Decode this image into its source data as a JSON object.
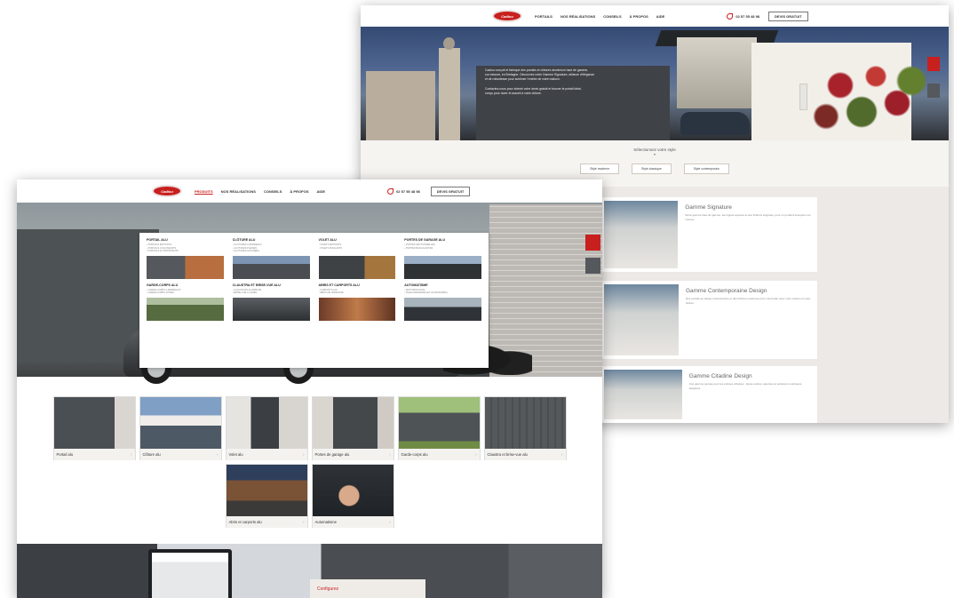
{
  "back_page": {
    "nav": {
      "logo_text": "Cadiou",
      "links": [
        "PORTAILS",
        "NOS RÉALISATIONS",
        "CONSEILS",
        "À PROPOS",
        "AIDE"
      ],
      "phone": "02 57 55 48 98",
      "quote_button": "DEVIS GRATUIT"
    },
    "hero_text": [
      "Cadiou conçoit et fabrique des portails et clôtures aluminium haut de gamme,",
      "sur mesure, en Bretagne. Découvrez notre Gamme Signature, alliance d'élégance",
      "et de robustesse pour sublimer l'entrée de votre maison.",
      "",
      "Contactez-nous pour obtenir votre devis gratuit et trouver le portail idéal,",
      "conçu pour durer et assorti à votre clôture."
    ],
    "finder": {
      "title": "Sélectionnez votre style",
      "arrow": "▾",
      "buttons": [
        "Style moderne",
        "Style classique",
        "Style contemporain"
      ]
    },
    "ranges": [
      {
        "title": "Gamme Signature",
        "text": "Notre gamme haut de gamme, aux lignes épurées et aux finitions soignées, pour un portail d'exception sur mesure."
      },
      {
        "title": "Gamme Contemporaine Design",
        "text": "Des portails au design contemporain et des finitions modernes pour s'accorder avec votre maison et votre clôture."
      },
      {
        "title": "Gamme Citadine Design",
        "text": "Une gamme pensée pour les entrées urbaines : lignes sobres, ajourées et solutions motorisées adaptées."
      }
    ]
  },
  "front_page": {
    "nav": {
      "logo_text": "Cadiou",
      "links": [
        "PRODUITS",
        "NOS RÉALISATIONS",
        "CONSEILS",
        "À PROPOS",
        "AIDE"
      ],
      "phone": "02 57 55 48 98",
      "quote_button": "DEVIS GRATUIT"
    },
    "mega_menu": [
      {
        "title": "PORTAIL ALU",
        "items": [
          "› PORTAILS BATTANTS",
          "› PORTAILS COULISSANTS",
          "› PORTAILS AUTOPORTANTS"
        ]
      },
      {
        "title": "CLÔTURE ALU",
        "items": [
          "› CLÔTURES À BARREAUX",
          "› CLÔTURES PLEINES",
          "› CLÔTURES AJOURÉES"
        ]
      },
      {
        "title": "VOLET ALU",
        "items": [
          "› VOLETS BATTANTS",
          "› VOLETS ROULANTS"
        ]
      },
      {
        "title": "PORTES DE GARAGE ALU",
        "items": [
          "› PORTES SECTIONNELLES",
          "› PORTES BASCULANTES"
        ]
      },
      {
        "title": "GARDE-CORPS ALU",
        "items": [
          "› GARDE-CORPS À BARREAUX",
          "› GARDE-CORPS VITRÉS"
        ]
      },
      {
        "title": "CLAUSTRA ET BRISE-VUE ALU",
        "items": [
          "› CLAUSTRAS ALUMINIUM",
          "› BRISE-VUE À LAMES"
        ]
      },
      {
        "title": "ABRIS ET CARPORTS ALU",
        "items": [
          "› CARPORTS ALU",
          "› ABRIS DE TERRASSE"
        ]
      },
      {
        "title": "AUTOMATISME",
        "items": [
          "› MOTORISATIONS",
          "› TÉLÉCOMMANDES ET ACCESSOIRES"
        ]
      }
    ],
    "tiles": [
      {
        "label": "Portail alu",
        "chev": "›"
      },
      {
        "label": "Clôture alu",
        "chev": "›"
      },
      {
        "label": "Volet alu",
        "chev": "›"
      },
      {
        "label": "Portes de garage alu",
        "chev": "›"
      },
      {
        "label": "Garde-corps alu",
        "chev": "›"
      },
      {
        "label": "Claustra et brise-vue alu",
        "chev": "›"
      },
      {
        "label": "Abris et carports alu",
        "chev": "›"
      },
      {
        "label": "Automatisme",
        "chev": "›"
      }
    ],
    "bottom_card_title": "Configurez"
  },
  "colors": {
    "brand_red": "#c8201e"
  }
}
